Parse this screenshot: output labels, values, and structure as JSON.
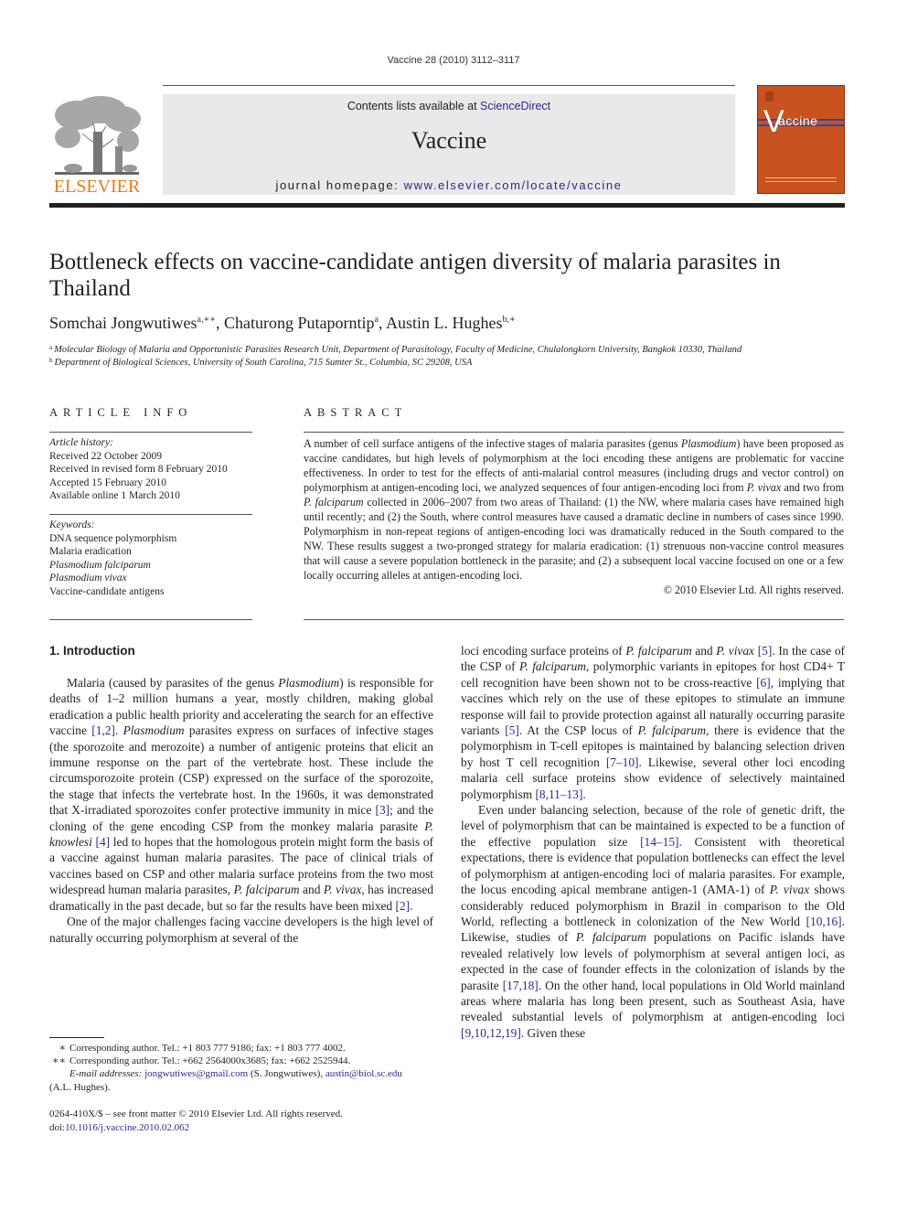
{
  "running_header": "Vaccine 28 (2010) 3112–3117",
  "masthead": {
    "contents_prefix": "Contents lists available at ",
    "contents_link": "ScienceDirect",
    "journal_name": "Vaccine",
    "homepage_prefix": "journal homepage: ",
    "homepage_link": "www.elsevier.com/locate/vaccine",
    "publisher_logo_text": "ELSEVIER",
    "cover_title": "accine",
    "cover_initial": "V",
    "colors": {
      "publisher_orange": "#e87a1e",
      "cover_orange": "#c8531f",
      "link_blue": "#2a2a8a",
      "masthead_grey": "#e9e9eb"
    }
  },
  "article": {
    "title": "Bottleneck effects on vaccine-candidate antigen diversity of malaria parasites in Thailand",
    "authors": [
      {
        "name": "Somchai Jongwutiwes",
        "sup": "a,∗∗",
        "sep": ", "
      },
      {
        "name": "Chaturong Putaporntip",
        "sup": "a",
        "sep": ", "
      },
      {
        "name": "Austin L. Hughes",
        "sup": "b,∗",
        "sep": ""
      }
    ],
    "affiliations": [
      {
        "mark": "a",
        "text": "Molecular Biology of Malaria and Opportunistic Parasites Research Unit, Department of Parasitology, Faculty of Medicine, Chulalongkorn University, Bangkok 10330, Thailand"
      },
      {
        "mark": "b",
        "text": "Department of Biological Sciences, University of South Carolina, 715 Sumter St., Columbia, SC 29208, USA"
      }
    ]
  },
  "article_info": {
    "heading": "ARTICLE INFO",
    "history_label": "Article history:",
    "history": [
      "Received 22 October 2009",
      "Received in revised form 8 February 2010",
      "Accepted 15 February 2010",
      "Available online 1 March 2010"
    ],
    "keywords_label": "Keywords:",
    "keywords": [
      {
        "text": "DNA sequence polymorphism",
        "italic": false
      },
      {
        "text": "Malaria eradication",
        "italic": false
      },
      {
        "text": "Plasmodium falciparum",
        "italic": true
      },
      {
        "text": "Plasmodium vivax",
        "italic": true
      },
      {
        "text": "Vaccine-candidate antigens",
        "italic": false
      }
    ]
  },
  "abstract": {
    "heading": "ABSTRACT",
    "segments": [
      {
        "t": "A number of cell surface antigens of the infective stages of malaria parasites (genus "
      },
      {
        "t": "Plasmodium",
        "i": true
      },
      {
        "t": ") have been proposed as vaccine candidates, but high levels of polymorphism at the loci encoding these antigens are problematic for vaccine effectiveness. In order to test for the effects of anti-malarial control measures (including drugs and vector control) on polymorphism at antigen-encoding loci, we analyzed sequences of four antigen-encoding loci from "
      },
      {
        "t": "P. vivax",
        "i": true
      },
      {
        "t": " and two from "
      },
      {
        "t": "P. falciparum",
        "i": true
      },
      {
        "t": " collected in 2006–2007 from two areas of Thailand: (1) the NW, where malaria cases have remained high until recently; and (2) the South, where control measures have caused a dramatic decline in numbers of cases since 1990. Polymorphism in non-repeat regions of antigen-encoding loci was dramatically reduced in the South compared to the NW. These results suggest a two-pronged strategy for malaria eradication: (1) strenuous non-vaccine control measures that will cause a severe population bottleneck in the parasite; and (2) a subsequent local vaccine focused on one or a few locally occurring alleles at antigen-encoding loci."
      }
    ],
    "copyright": "© 2010 Elsevier Ltd. All rights reserved."
  },
  "body": {
    "section_heading": "1.  Introduction",
    "left_column": [
      [
        {
          "t": "Malaria (caused by parasites of the genus "
        },
        {
          "t": "Plasmodium",
          "i": true
        },
        {
          "t": ") is responsible for deaths of 1–2 million humans a year, mostly children, making global eradication a public health priority and accelerating the search for an effective vaccine "
        },
        {
          "t": "[1,2]",
          "ref": true
        },
        {
          "t": ". "
        },
        {
          "t": "Plasmodium",
          "i": true
        },
        {
          "t": " parasites express on surfaces of infective stages (the sporozoite and merozoite) a number of antigenic proteins that elicit an immune response on the part of the vertebrate host. These include the circumsporozoite protein (CSP) expressed on the surface of the sporozoite, the stage that infects the vertebrate host. In the 1960s, it was demonstrated that X-irradiated sporozoites confer protective immunity in mice "
        },
        {
          "t": "[3]",
          "ref": true
        },
        {
          "t": "; and the cloning of the gene encoding CSP from the monkey malaria parasite "
        },
        {
          "t": "P. knowlesi",
          "i": true
        },
        {
          "t": " "
        },
        {
          "t": "[4]",
          "ref": true
        },
        {
          "t": " led to hopes that the homologous protein might form the basis of a vaccine against human malaria parasites. The pace of clinical trials of vaccines based on CSP and other malaria surface proteins from the two most widespread human malaria parasites, "
        },
        {
          "t": "P. falciparum",
          "i": true
        },
        {
          "t": " and "
        },
        {
          "t": "P. vivax",
          "i": true
        },
        {
          "t": ", has increased dramatically in the past decade, but so far the results have been mixed "
        },
        {
          "t": "[2]",
          "ref": true
        },
        {
          "t": "."
        }
      ],
      [
        {
          "t": "One of the major challenges facing vaccine developers is the high level of naturally occurring polymorphism at several of the"
        }
      ]
    ],
    "right_column": [
      [
        {
          "t": "loci encoding surface proteins of "
        },
        {
          "t": "P. falciparum",
          "i": true
        },
        {
          "t": " and "
        },
        {
          "t": "P. vivax",
          "i": true
        },
        {
          "t": " "
        },
        {
          "t": "[5]",
          "ref": true
        },
        {
          "t": ". In the case of the CSP of "
        },
        {
          "t": "P. falciparum",
          "i": true
        },
        {
          "t": ", polymorphic variants in epitopes for host CD4+ T cell recognition have been shown not to be cross-reactive "
        },
        {
          "t": "[6]",
          "ref": true
        },
        {
          "t": ", implying that vaccines which rely on the use of these epitopes to stimulate an immune response will fail to provide protection against all naturally occurring parasite variants "
        },
        {
          "t": "[5]",
          "ref": true
        },
        {
          "t": ". At the CSP locus of "
        },
        {
          "t": "P. falciparum",
          "i": true
        },
        {
          "t": ", there is evidence that the polymorphism in T-cell epitopes is maintained by balancing selection driven by host T cell recognition "
        },
        {
          "t": "[7–10]",
          "ref": true
        },
        {
          "t": ". Likewise, several other loci encoding malaria cell surface proteins show evidence of selectively maintained polymorphism "
        },
        {
          "t": "[8,11–13]",
          "ref": true
        },
        {
          "t": "."
        }
      ],
      [
        {
          "t": "Even under balancing selection, because of the role of genetic drift, the level of polymorphism that can be maintained is expected to be a function of the effective population size "
        },
        {
          "t": "[14–15]",
          "ref": true
        },
        {
          "t": ". Consistent with theoretical expectations, there is evidence that population bottlenecks can effect the level of polymorphism at antigen-encoding loci of malaria parasites. For example, the locus encoding apical membrane antigen-1 (AMA-1) of "
        },
        {
          "t": "P. vivax",
          "i": true
        },
        {
          "t": " shows considerably reduced polymorphism in Brazil in comparison to the Old World, reflecting a bottleneck in colonization of the New World "
        },
        {
          "t": "[10,16]",
          "ref": true
        },
        {
          "t": ". Likewise, studies of "
        },
        {
          "t": "P. falciparum",
          "i": true
        },
        {
          "t": " populations on Pacific islands have revealed relatively low levels of polymorphism at several antigen loci, as expected in the case of founder effects in the colonization of islands by the parasite "
        },
        {
          "t": "[17,18]",
          "ref": true
        },
        {
          "t": ". On the other hand, local populations in Old World mainland areas where malaria has long been present, such as Southeast Asia, have revealed substantial levels of polymorphism at antigen-encoding loci "
        },
        {
          "t": "[9,10,12,19]",
          "ref": true
        },
        {
          "t": ". Given these"
        }
      ]
    ]
  },
  "footnotes": {
    "items": [
      {
        "mark": "∗",
        "text": "Corresponding author. Tel.: +1 803 777 9186; fax: +1 803 777 4002."
      },
      {
        "mark": "∗∗",
        "text": "Corresponding author. Tel.: +662 2564000x3685; fax: +662 2525944."
      }
    ],
    "email_label": "E-mail addresses:",
    "email_1": "jongwutiwes@gmail.com",
    "email_1_owner": " (S. Jongwutiwes), ",
    "email_2": "austin@biol.sc.edu",
    "email_2_owner": "(A.L. Hughes)."
  },
  "front_matter": {
    "issn_line": "0264-410X/$ – see front matter © 2010 Elsevier Ltd. All rights reserved.",
    "doi_prefix": "doi:",
    "doi": "10.1016/j.vaccine.2010.02.062"
  }
}
